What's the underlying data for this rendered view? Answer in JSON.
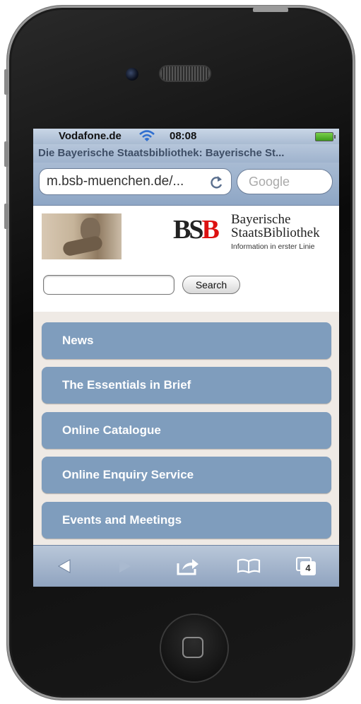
{
  "status": {
    "carrier": "Vodafone.de",
    "time": "08:08"
  },
  "browser": {
    "page_title": "Die Bayerische Staatsbibliothek: Bayerische St...",
    "url": "m.bsb-muenchen.de/...",
    "search_placeholder": "Google",
    "tabs_count": "4"
  },
  "page": {
    "logo": {
      "mark_left": "BS",
      "mark_right": "B",
      "name_line1": "Bayerische",
      "name_line2": "StaatsBibliothek",
      "tagline": "Information in erster Linie"
    },
    "search_button": "Search",
    "menu": [
      {
        "label": "News"
      },
      {
        "label": "The Essentials in Brief"
      },
      {
        "label": "Online Catalogue"
      },
      {
        "label": "Online Enquiry Service"
      },
      {
        "label": "Events and Meetings"
      }
    ]
  },
  "colors": {
    "menu_item": "#7f9dbd",
    "menu_bg": "#efeae5",
    "logo_red": "#dd1111",
    "toolbar": "#9fb2cb"
  },
  "icons": [
    "signal-icon",
    "wifi-icon",
    "battery-icon",
    "reload-icon",
    "back-icon",
    "forward-icon",
    "share-icon",
    "bookmarks-icon",
    "tabs-icon"
  ]
}
